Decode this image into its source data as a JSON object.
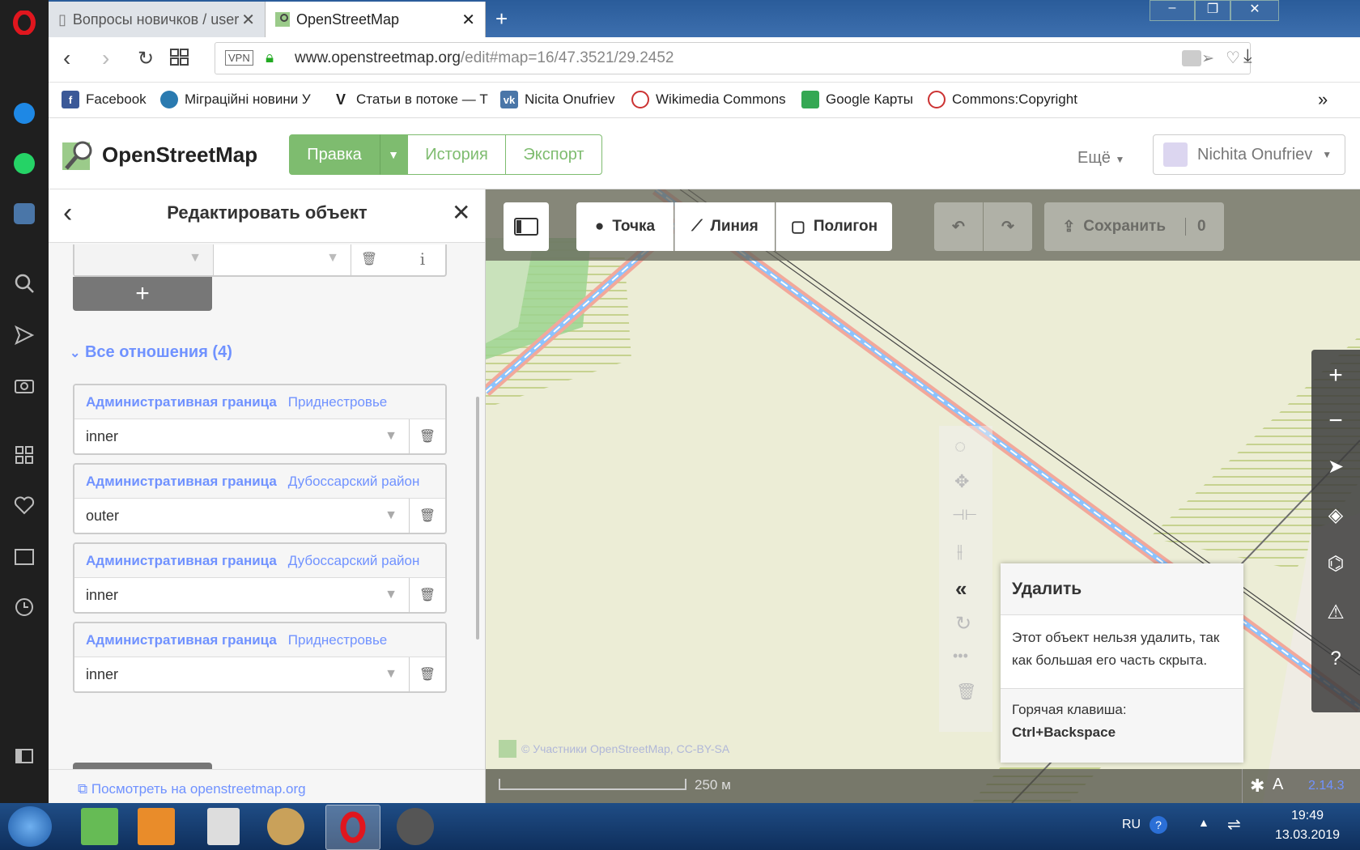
{
  "browser": {
    "tabs": [
      {
        "title": "Вопросы новичков / user",
        "active": false
      },
      {
        "title": "OpenStreetMap",
        "active": true
      }
    ],
    "vpn_badge": "VPN",
    "url_domain": "www.openstreetmap.org",
    "url_path": "/edit#map=16/47.3521/29.2452",
    "bookmarks": [
      {
        "label": "Facebook",
        "icon": "facebook-icon",
        "color": "#3b5998"
      },
      {
        "label": "Міграційні новини У",
        "icon": "globe-icon",
        "color": "#2a7ab0"
      },
      {
        "label": "Статьи в потоке — Т",
        "icon": "v-icon",
        "color": "#222222"
      },
      {
        "label": "Nicita Onufriev",
        "icon": "vk-icon",
        "color": "#4a76a8"
      },
      {
        "label": "Wikimedia Commons",
        "icon": "wikimedia-icon",
        "color": "#c33"
      },
      {
        "label": "Google Карты",
        "icon": "maps-icon",
        "color": "#34a853"
      },
      {
        "label": "Commons:Copyright",
        "icon": "wikimedia-icon",
        "color": "#c33"
      }
    ],
    "bookmarks_more": "»"
  },
  "osm": {
    "logo_text": "OpenStreetMap",
    "nav": {
      "edit": "Правка",
      "history": "История",
      "export": "Экспорт"
    },
    "more": "Ещё",
    "user": "Nichita Onufriev"
  },
  "panel": {
    "title": "Редактировать объект",
    "add_label": "+",
    "relations_heading": "Все отношения (4)",
    "relations": [
      {
        "type": "Административная граница",
        "name": "Приднестровье",
        "role": "inner"
      },
      {
        "type": "Административная граница",
        "name": "Дубоссарский район",
        "role": "outer"
      },
      {
        "type": "Административная граница",
        "name": "Дубоссарский район",
        "role": "inner"
      },
      {
        "type": "Административная граница",
        "name": "Приднестровье",
        "role": "inner"
      }
    ],
    "view_link": "Посмотреть на openstreetmap.org"
  },
  "map": {
    "tools": {
      "point": "Точка",
      "line": "Линия",
      "area": "Полигон"
    },
    "save": "Сохранить",
    "save_count": "0",
    "tooltip": {
      "title": "Удалить",
      "body": "Этот объект нельзя удалить, так как большая его часть скрыта.",
      "hotkey_label": "Горячая клавиша:",
      "hotkey": "Ctrl+Backspace"
    },
    "attribution": "© Участники OpenStreetMap, CC-BY-SA",
    "scale": "250 м",
    "version": "2.14.3"
  },
  "taskbar": {
    "lang": "RU",
    "time": "19:49",
    "date": "13.03.2019"
  }
}
